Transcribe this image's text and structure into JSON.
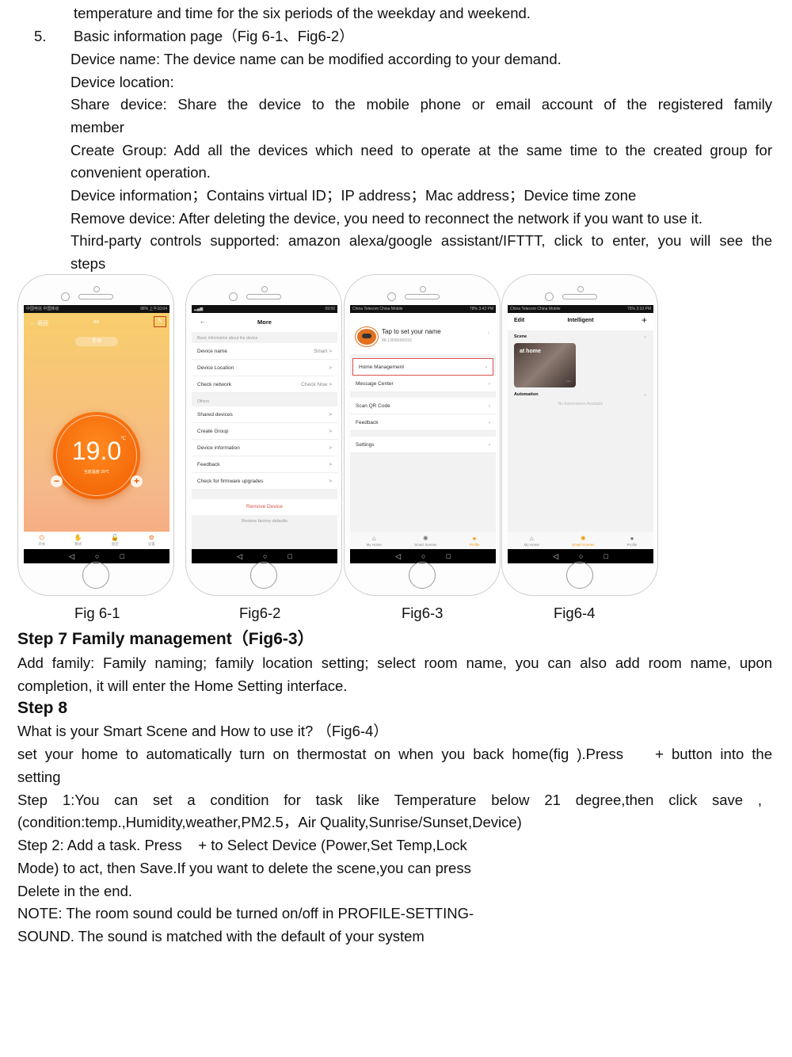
{
  "intro": {
    "line0": "temperature and time for the six periods of the weekday and weekend.",
    "item_number": "5.",
    "item_title": "Basic information page（Fig 6-1、Fig6-2）",
    "device_name": "Device name: The device name can be modified according to your demand.",
    "device_location": "Device location:",
    "share_device_1": "Share device: Share the device to the mobile phone or email account of the registered family",
    "share_device_2": "member",
    "create_group_1": "Create Group: Add all the devices which need to operate at the same time to the created group for",
    "create_group_2": "convenient operation.",
    "device_information": "Device information；Contains virtual ID；IP address；Mac address；Device time zone",
    "remove_device": "Remove device: After deleting the device, you need to reconnect the network if you want to use it.",
    "third_party_1": "Third-party controls supported: amazon alexa/google assistant/IFTTT, click to enter, you will see the",
    "third_party_2": "steps"
  },
  "figures": {
    "fig1": {
      "caption": "Fig 6-1",
      "status_left": "中国电信 中国移动",
      "status_right": "98% 上午10:04",
      "back_label": "← 返回",
      "title": "xx",
      "mode_pill": "手动",
      "temperature": "19.0",
      "unit": "℃",
      "current_temp": "当前温度 29℃",
      "minus": "−",
      "plus": "+",
      "tabs": [
        {
          "icon": "power-icon",
          "glyph": "⏻",
          "label": "开关"
        },
        {
          "icon": "hand-icon",
          "glyph": "✋",
          "label": "模式"
        },
        {
          "icon": "lock-icon",
          "glyph": "🔓",
          "label": "锁定"
        },
        {
          "icon": "gear-icon",
          "glyph": "⚙",
          "label": "设置"
        }
      ],
      "accent": "#f06a10"
    },
    "fig2": {
      "caption": "Fig6-2",
      "status_right": "09:56",
      "title": "More",
      "section1": "Basic information about the device",
      "rows1": [
        {
          "label": "Device name",
          "value": "Smart >"
        },
        {
          "label": "Device Location",
          "value": ">"
        },
        {
          "label": "Check network",
          "value": "Check Now >"
        }
      ],
      "section2": "Others",
      "rows2": [
        {
          "label": "Shared devices",
          "value": ">"
        },
        {
          "label": "Create Group",
          "value": ">"
        },
        {
          "label": "Device information",
          "value": ">"
        },
        {
          "label": "Feedback",
          "value": ">"
        },
        {
          "label": "Check for firmware upgrades",
          "value": ">"
        }
      ],
      "remove": "Remove Device",
      "restore": "Restore factory defaults",
      "remove_color": "#d9534f"
    },
    "fig3": {
      "caption": "Fig6-3",
      "status_left": "China Telecom China Mobile",
      "status_right": "78% 3:42 PM",
      "profile_name": "Tap to set your name",
      "profile_phone": "86-13595000193",
      "rows_a": [
        "Home Management",
        "Message Center"
      ],
      "rows_b": [
        "Scan QR Code",
        "Feedback"
      ],
      "rows_c": [
        "Settings"
      ],
      "tabs": [
        {
          "icon": "home-icon",
          "glyph": "⌂",
          "label": "My Home"
        },
        {
          "icon": "sun-icon",
          "glyph": "✺",
          "label": "Smart Scenes"
        },
        {
          "icon": "profile-icon",
          "glyph": "●",
          "label": "Profile"
        }
      ]
    },
    "fig4": {
      "caption": "Fig6-4",
      "status_left": "China Telecom China Mobile",
      "status_right": "75% 3:10 PM",
      "edit": "Edit",
      "title": "Intelligent",
      "add": "+",
      "scene_label": "Scene",
      "scene_card": "at home",
      "automation_label": "Automation",
      "no_automation": "No Automations Available",
      "tabs": [
        {
          "icon": "home-icon",
          "glyph": "⌂",
          "label": "My Home"
        },
        {
          "icon": "sun-icon",
          "glyph": "✺",
          "label": "Smart Scenes"
        },
        {
          "icon": "profile-icon",
          "glyph": "●",
          "label": "Profile"
        }
      ]
    }
  },
  "step7": {
    "heading": "Step 7 Family management（Fig6-3）",
    "text1": "Add family: Family naming; family location setting; select room name, you can also add room name, upon",
    "text2": "completion, it will enter the Home Setting interface."
  },
  "step8": {
    "heading": "Step 8",
    "question": "What is your Smart Scene and How to use it? （Fig6-4）",
    "p1a": "set your home to automatically turn on thermostat on when you back home(fig ).Press    + button into the",
    "p1b": "setting",
    "s1a": "Step 1:You can set a condition for task like Temperature below 21 degree,then click save ,",
    "s1b": "(condition:temp.,Humidity,weather,PM2.5，Air Quality,Sunrise/Sunset,Device)",
    "s2a": "Step 2: Add a task. Press    + to Select Device (Power,Set Temp,Lock",
    "s2b": "Mode) to act, then Save.If you want to delete the scene,you can press",
    "s2c": "Delete in the end.",
    "note1": "NOTE: The room sound could be turned on/off in PROFILE-SETTING-",
    "note2": "SOUND. The sound is matched with the default of your system"
  }
}
